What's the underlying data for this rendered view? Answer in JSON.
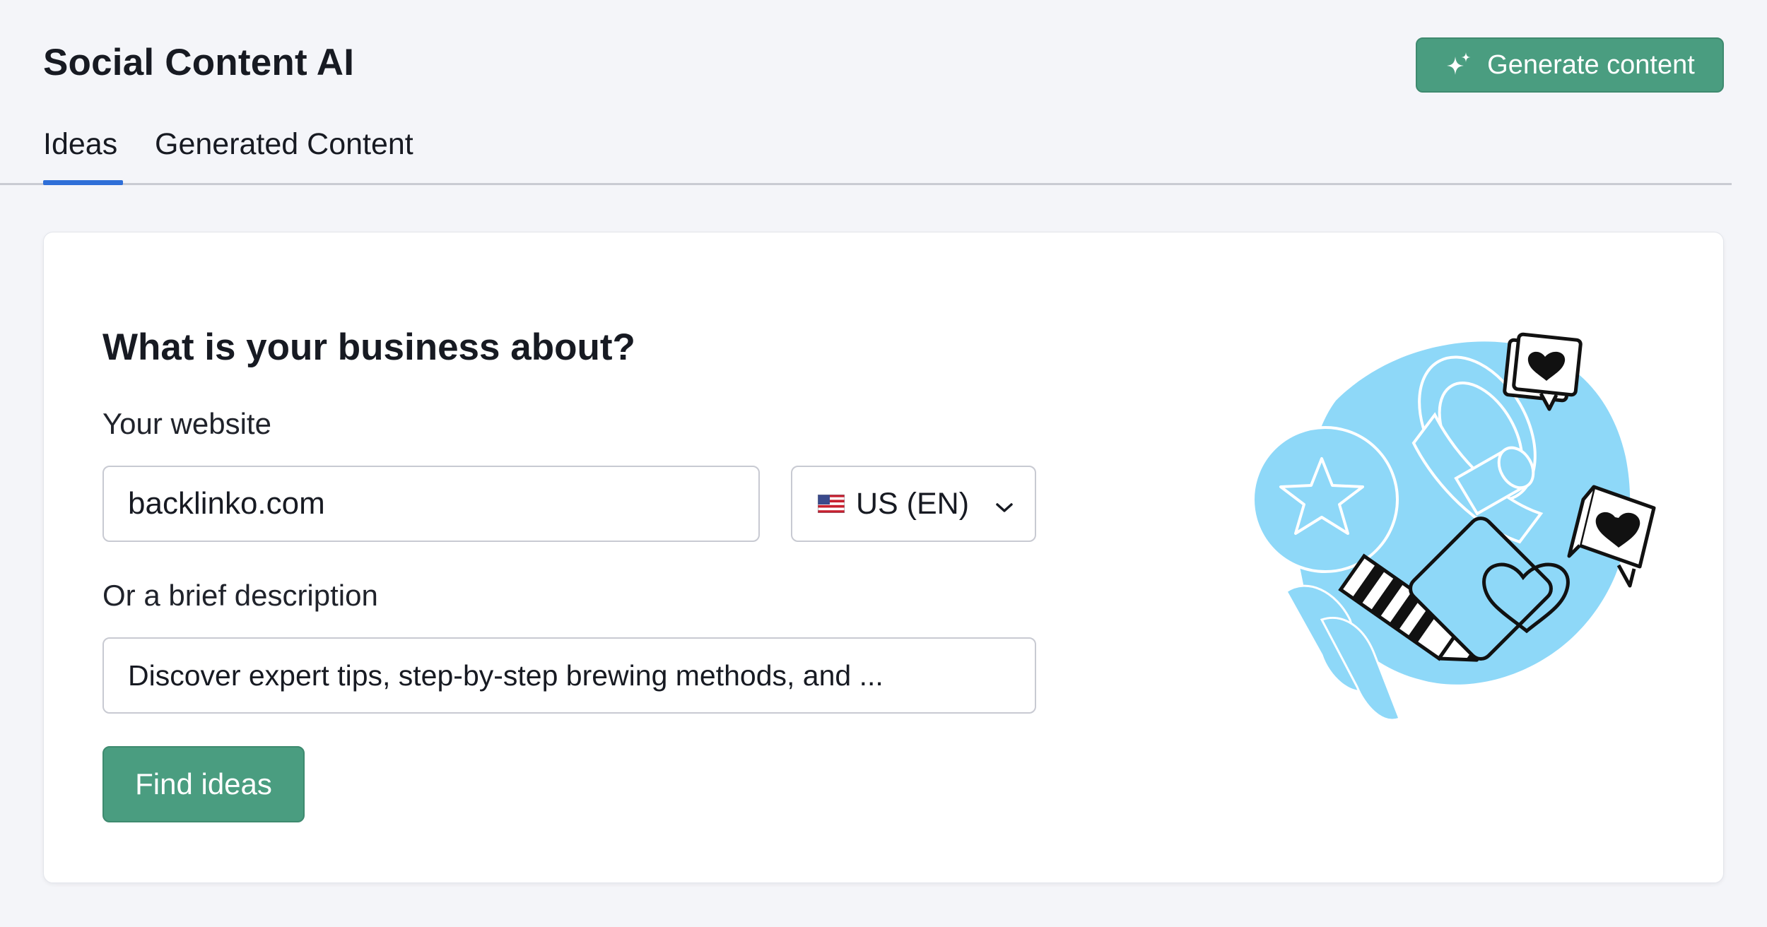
{
  "header": {
    "title": "Social Content AI",
    "generate_label": "Generate content",
    "generate_icon": "sparkles-icon"
  },
  "tabs": [
    {
      "label": "Ideas",
      "active": true
    },
    {
      "label": "Generated Content",
      "active": false
    }
  ],
  "form": {
    "heading": "What is your business about?",
    "website_label": "Your website",
    "website_value": "backlinko.com",
    "locale": {
      "value": "US (EN)",
      "flag_icon": "us-flag-icon",
      "chevron_icon": "chevron-down-icon"
    },
    "description_label": "Or a brief description",
    "description_value": "Discover expert tips, step-by-step brewing methods, and ...",
    "submit_label": "Find ideas"
  },
  "illustration": {
    "icon": "social-megaphone-illustration"
  },
  "colors": {
    "background": "#f4f5f9",
    "card": "#ffffff",
    "primary_button": "#4a9d80",
    "active_tab_underline": "#2f6fd8",
    "text": "#171a22",
    "field_border": "#c8cad2",
    "illustration_blue": "#8ed8f8"
  }
}
